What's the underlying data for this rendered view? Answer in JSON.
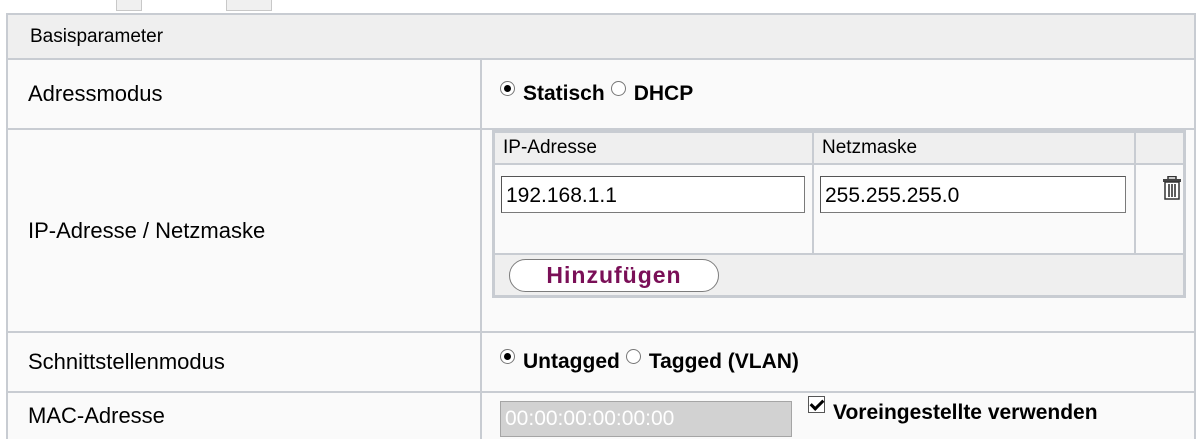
{
  "section": {
    "title": "Basisparameter"
  },
  "address_mode": {
    "label": "Adressmodus",
    "options": [
      {
        "label": "Statisch",
        "selected": true
      },
      {
        "label": "DHCP",
        "selected": false
      }
    ]
  },
  "ip_netmask": {
    "label": "IP-Adresse / Netzmaske",
    "columns": [
      "IP-Adresse",
      "Netzmaske"
    ],
    "rows": [
      {
        "ip": "192.168.1.1",
        "netmask": "255.255.255.0"
      }
    ],
    "delete_icon": "trash-icon",
    "add_button": "Hinzufügen"
  },
  "interface_mode": {
    "label": "Schnittstellenmodus",
    "options": [
      {
        "label": "Untagged",
        "selected": true
      },
      {
        "label": "Tagged (VLAN)",
        "selected": false
      }
    ]
  },
  "mac": {
    "label": "MAC-Adresse",
    "value": "00:00:00:00:00:00",
    "use_default_label": "Voreingestellte verwenden",
    "use_default_checked": true
  },
  "colors": {
    "add_button_text": "#7a0f57",
    "header_bg": "#efefef",
    "grid": "#c8ccd2"
  }
}
